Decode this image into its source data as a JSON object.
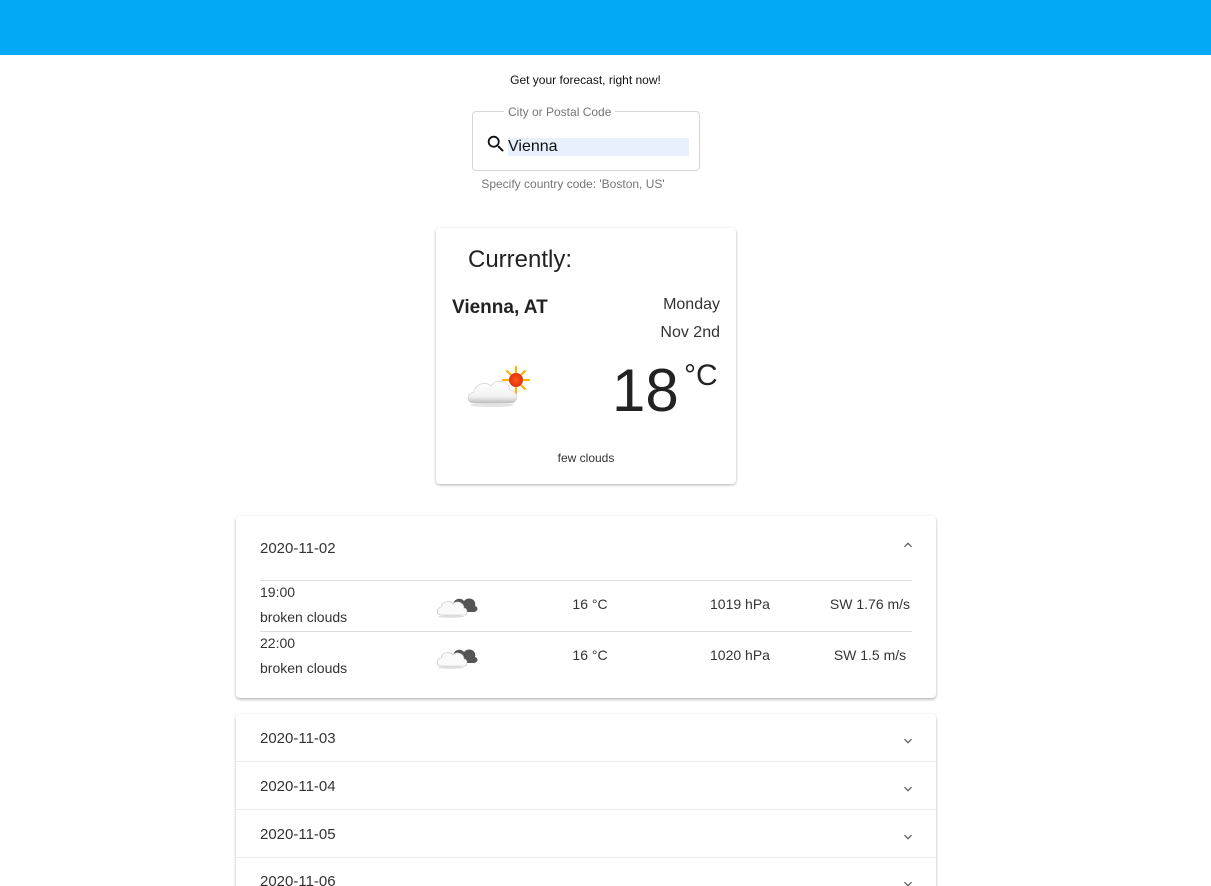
{
  "colors": {
    "app_bar": "#03a9f4",
    "input_fill": "#e8f0fe"
  },
  "tagline": "Get your forecast, right now!",
  "search": {
    "label": "City or Postal Code",
    "value": "Vienna",
    "hint": "Specify country code: 'Boston, US'",
    "icon": "search-icon"
  },
  "current": {
    "title": "Currently:",
    "city": "Vienna, AT",
    "day": "Monday",
    "date": "Nov 2nd",
    "temp": "18",
    "unit": "°C",
    "description": "few clouds",
    "icon": "few-clouds-icon"
  },
  "forecast": {
    "days": [
      {
        "date": "2020-11-02",
        "expanded": true,
        "hours": [
          {
            "time": "19:00",
            "description": "broken clouds",
            "temp": "16 °C",
            "pressure": "1019 hPa",
            "wind": "SW 1.76 m/s",
            "icon": "broken-clouds-icon"
          },
          {
            "time": "22:00",
            "description": "broken clouds",
            "temp": "16 °C",
            "pressure": "1020 hPa",
            "wind": "SW 1.5 m/s",
            "icon": "broken-clouds-icon"
          }
        ]
      },
      {
        "date": "2020-11-03",
        "expanded": false
      },
      {
        "date": "2020-11-04",
        "expanded": false
      },
      {
        "date": "2020-11-05",
        "expanded": false
      },
      {
        "date": "2020-11-06",
        "expanded": false
      }
    ]
  }
}
